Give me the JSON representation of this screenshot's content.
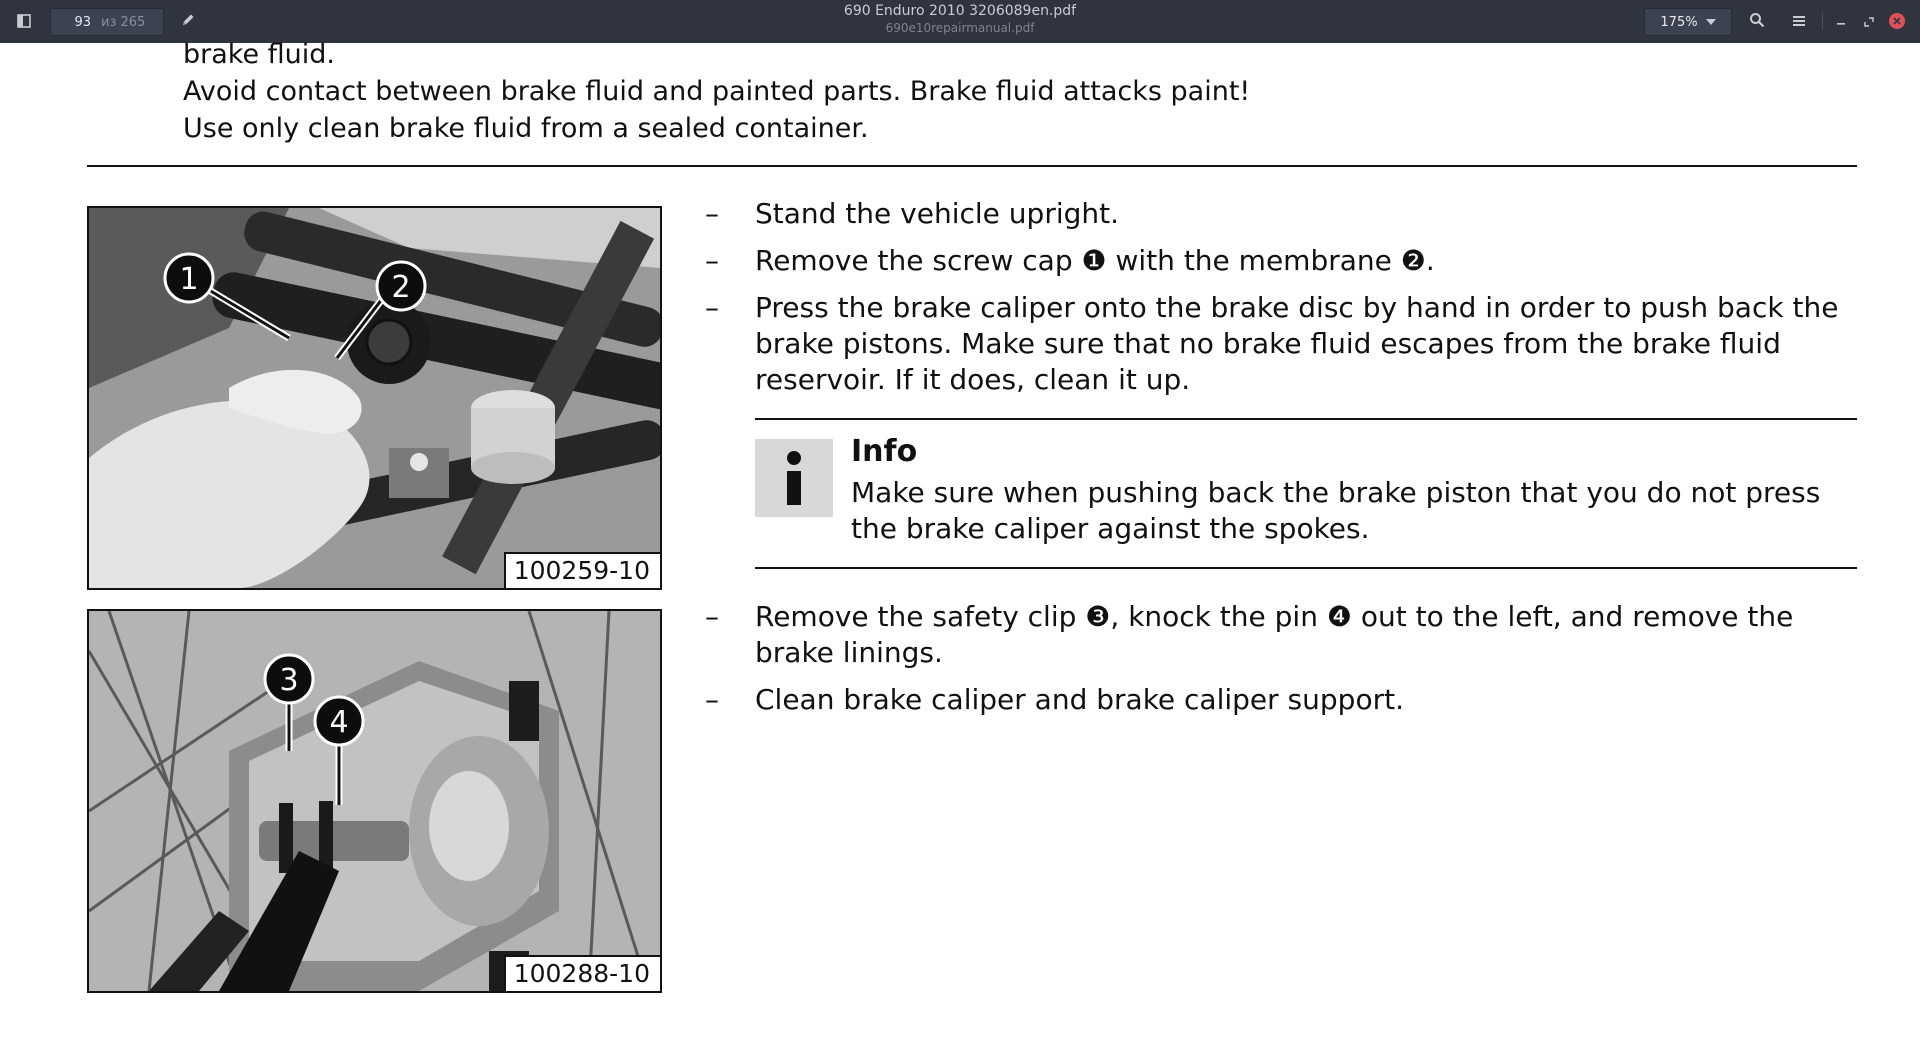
{
  "viewer": {
    "page_current": "93",
    "page_total": "из 265",
    "title": "690 Enduro 2010 3206089en.pdf",
    "subtitle": "690e10repairmanual.pdf",
    "zoom": "175%",
    "icons": [
      "sidebar-toggle-icon",
      "pencil-icon",
      "search-icon",
      "menu-icon",
      "minimize-icon",
      "maximize-icon",
      "close-icon"
    ]
  },
  "document": {
    "warning_lines": [
      "brake fluid.",
      "Avoid contact between brake fluid and painted parts. Brake fluid attacks paint!",
      "Use only clean brake fluid from a sealed container."
    ],
    "figure_1": {
      "code": "100259-10",
      "callouts": [
        "1",
        "2"
      ]
    },
    "figure_2": {
      "code": "100288-10",
      "callouts": [
        "3",
        "4"
      ]
    },
    "steps_a": [
      {
        "dash": "–",
        "text": "Stand the vehicle upright."
      },
      {
        "dash": "–",
        "text": "Remove the screw cap ❶ with the membrane ❷."
      },
      {
        "dash": "–",
        "text": "Press the brake caliper onto the brake disc by hand in order to push back the brake pistons. Make sure that no brake fluid escapes from the brake fluid reservoir. If it does, clean it up."
      }
    ],
    "info": {
      "title": "Info",
      "text": "Make sure when pushing back the brake piston that you do not press the brake caliper against the spokes."
    },
    "steps_b": [
      {
        "dash": "–",
        "text": "Remove the safety clip ❸, knock the pin ❹ out to the left, and remove the brake linings."
      },
      {
        "dash": "–",
        "text": "Clean brake caliper and brake caliper support."
      }
    ]
  }
}
